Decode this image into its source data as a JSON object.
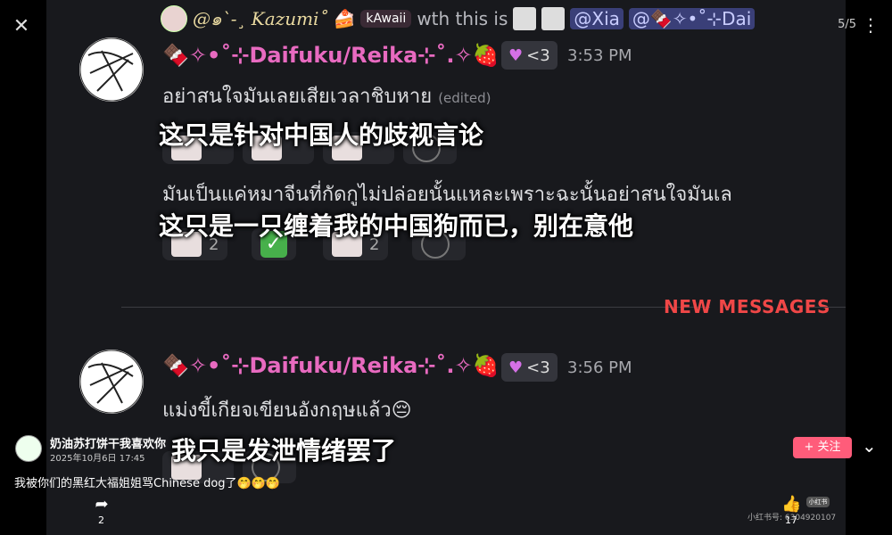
{
  "viewer": {
    "counter": "5/5",
    "close_icon": "close-icon",
    "more_icon": "more-icon"
  },
  "reply_bar": {
    "decor_name": "@๑`-¸ Kazumi˚",
    "badge": "kAwaii",
    "text": "wth this is",
    "mention1": "@Xia",
    "mention2": "@🍫✧•˚⊹Dai"
  },
  "messages": [
    {
      "username": "🍫✧•˚⊹Daifuku/Reika⊹˚.✧🍓",
      "badge": "<3",
      "time": "3:53 PM",
      "text1": "อย่าสนใจมันเลยเสียเวลาชิบหาย",
      "edited": "(edited)",
      "subtitle1": "这只是针对中国人的歧视言论",
      "text2": "มันเป็นแค่หมาจีนที่กัดกูไม่ปล่อยนั้นแหละเพราะฉะนั้นอย่าสนใจมันเล",
      "subtitle2": "这只是一只缠着我的中国狗而已，别在意他",
      "reactions_count": [
        "2",
        "2"
      ]
    },
    {
      "username": "🍫✧•˚⊹Daifuku/Reika⊹˚.✧🍓",
      "badge": "<3",
      "time": "3:56 PM",
      "text1": "แม่งขี้เกียจเขียนอังกฤษแล้ว😔",
      "subtitle1": "我只是发泄情绪罢了"
    }
  ],
  "divider_label": "NEW MESSAGES",
  "overlay": {
    "author": "奶油苏打饼干我喜欢你",
    "date": "2025年10月6日 17:45",
    "follow": "+ 关注",
    "caption": "我被你们的黑红大福姐姐骂Chinese dog了🤭🤭🤭",
    "share_count": "2",
    "like_count": "17",
    "logo": "小红书",
    "watermark": "小红书号: 6304920107"
  }
}
